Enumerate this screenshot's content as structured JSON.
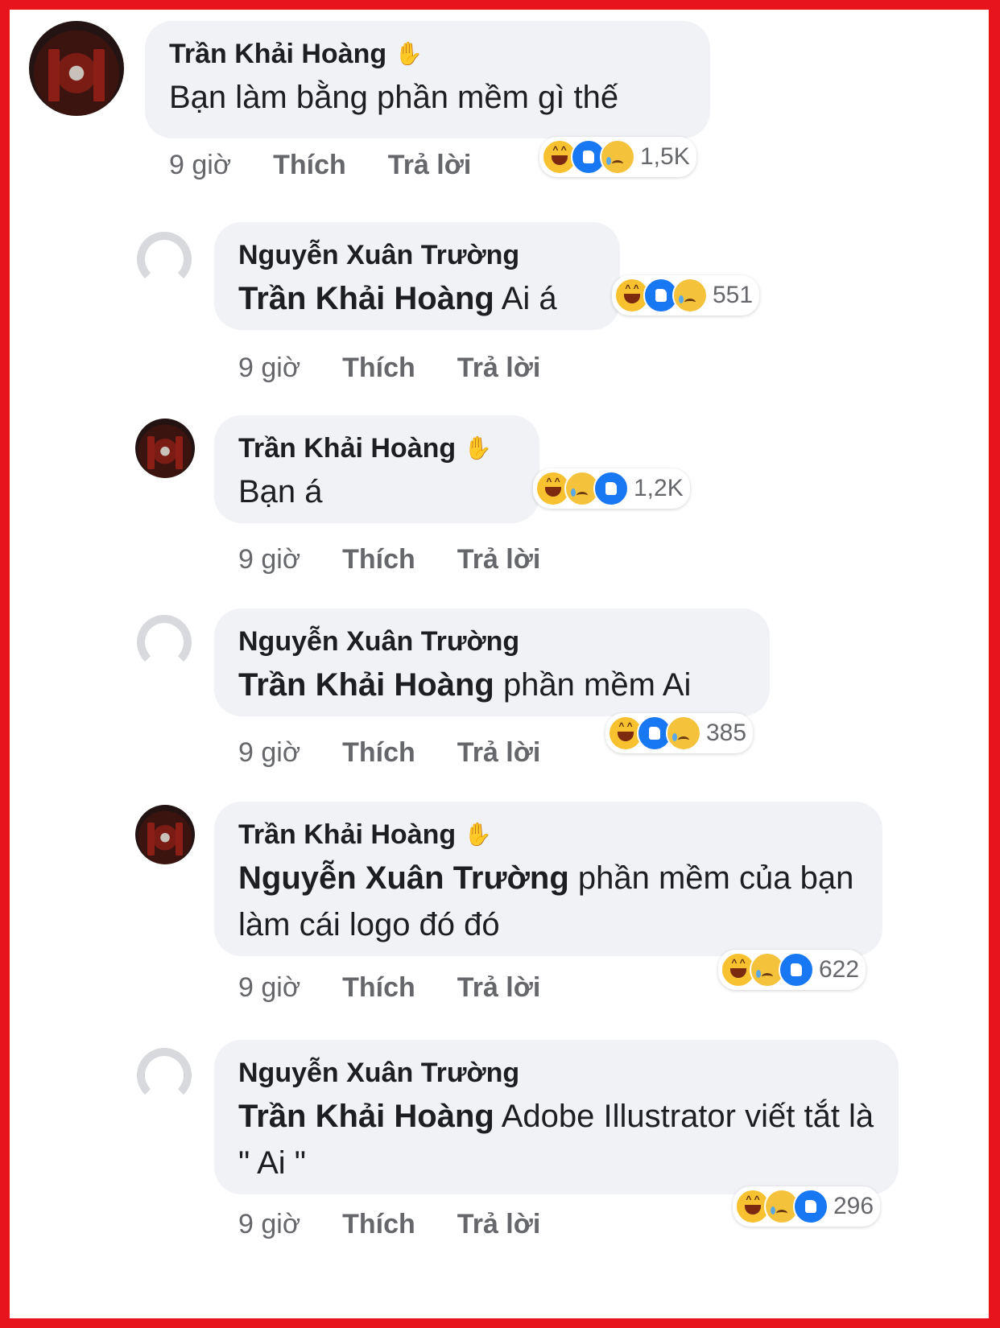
{
  "comments": [
    {
      "author": "Trần Khải Hoàng",
      "tag": "",
      "text": "Bạn làm bằng phần mềm gì thế",
      "time": "9 giờ",
      "like": "Thích",
      "reply": "Trả lời",
      "reactions": [
        "haha",
        "like",
        "sad"
      ],
      "count": "1,5K"
    },
    {
      "author": "Nguyễn Xuân Trường",
      "tag": "Trần Khải Hoàng",
      "text": "Ai á",
      "time": "9 giờ",
      "like": "Thích",
      "reply": "Trả lời",
      "reactions": [
        "haha",
        "like",
        "sad"
      ],
      "count": "551"
    },
    {
      "author": "Trần Khải Hoàng",
      "tag": "",
      "text": "Bạn á",
      "time": "9 giờ",
      "like": "Thích",
      "reply": "Trả lời",
      "reactions": [
        "haha",
        "sad",
        "like"
      ],
      "count": "1,2K"
    },
    {
      "author": "Nguyễn Xuân Trường",
      "tag": "Trần Khải Hoàng",
      "text": "phần mềm Ai",
      "time": "9 giờ",
      "like": "Thích",
      "reply": "Trả lời",
      "reactions": [
        "haha",
        "like",
        "sad"
      ],
      "count": "385"
    },
    {
      "author": "Trần Khải Hoàng",
      "tag": "Nguyễn Xuân Trường",
      "text": "phần mềm của bạn làm cái logo đó đó",
      "time": "9 giờ",
      "like": "Thích",
      "reply": "Trả lời",
      "reactions": [
        "haha",
        "sad",
        "like"
      ],
      "count": "622"
    },
    {
      "author": "Nguyễn Xuân Trường",
      "tag": "Trần Khải Hoàng",
      "text": "Adobe Illustrator viết tắt là \" Ai \"",
      "time": "9 giờ",
      "like": "Thích",
      "reply": "Trả lời",
      "reactions": [
        "haha",
        "sad",
        "like"
      ],
      "count": "296"
    }
  ],
  "icons": {
    "verified_hand": "✋"
  },
  "colors": {
    "frame_border": "#e8141b",
    "bubble_bg": "#f0f2f5",
    "like_blue": "#1877f2",
    "haha_yellow": "#f7c12f"
  }
}
